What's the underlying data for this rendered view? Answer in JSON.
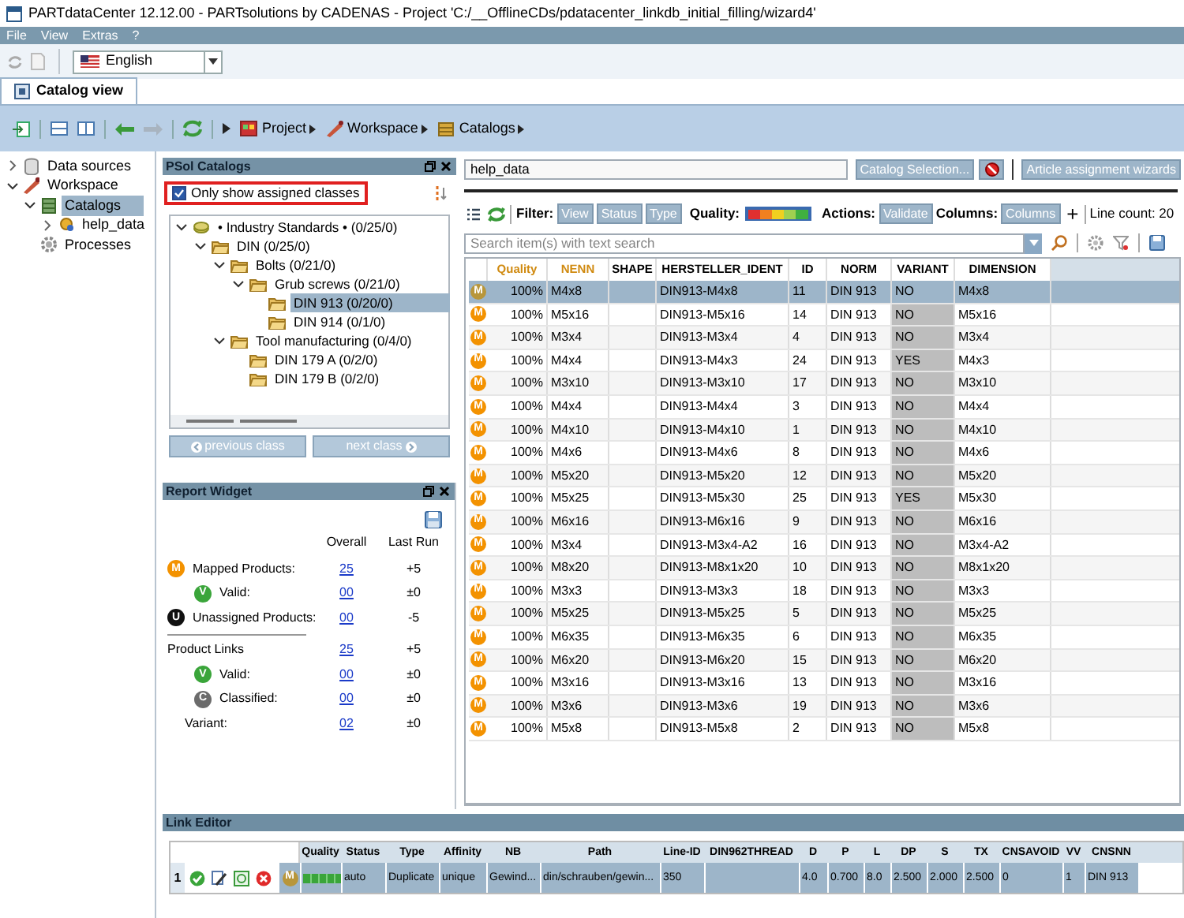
{
  "window": {
    "title": "PARTdataCenter 12.12.00 - PARTsolutions by CADENAS - Project 'C:/__OfflineCDs/pdatacenter_linkdb_initial_filling/wizard4'"
  },
  "menu": [
    "File",
    "View",
    "Extras",
    "?"
  ],
  "language": {
    "value": "English"
  },
  "tabs": [
    {
      "label": "Catalog view",
      "selected": true
    }
  ],
  "breadcrumbs": [
    {
      "label": "Project",
      "kind": "project"
    },
    {
      "label": "Workspace",
      "kind": "workspace"
    },
    {
      "label": "Catalogs",
      "kind": "catalogs"
    }
  ],
  "nav_tree": [
    {
      "label": "Data sources",
      "kind": "datasource",
      "expanded": false,
      "selected": false
    },
    {
      "label": "Workspace",
      "kind": "workspace",
      "expanded": true,
      "selected": false,
      "children": [
        {
          "label": "Catalogs",
          "kind": "catalogs",
          "expanded": true,
          "selected": true,
          "children": [
            {
              "label": "help_data",
              "kind": "catalog",
              "expanded": false,
              "selected": false
            }
          ]
        },
        {
          "label": "Processes",
          "kind": "processes",
          "selected": false
        }
      ]
    }
  ],
  "psol_catalogs": {
    "title": "PSol Catalogs",
    "checkbox": {
      "label": "Only show assigned classes",
      "checked": true
    },
    "tree": [
      {
        "label": "• Industry Standards •",
        "count": "(0/25/0)",
        "kind": "standards",
        "expanded": true,
        "selected": false,
        "children": [
          {
            "label": "DIN",
            "count": "(0/25/0)",
            "kind": "folder",
            "expanded": true,
            "selected": false,
            "children": [
              {
                "label": "Bolts",
                "count": "(0/21/0)",
                "kind": "folder",
                "expanded": true,
                "selected": false,
                "children": [
                  {
                    "label": "Grub screws",
                    "count": "(0/21/0)",
                    "kind": "folder",
                    "expanded": true,
                    "selected": false,
                    "children": [
                      {
                        "label": "DIN 913",
                        "count": "(0/20/0)",
                        "kind": "folder",
                        "selected": true
                      },
                      {
                        "label": "DIN 914",
                        "count": "(0/1/0)",
                        "kind": "folder",
                        "selected": false
                      }
                    ]
                  }
                ]
              },
              {
                "label": "Tool manufacturing",
                "count": "(0/4/0)",
                "kind": "folder",
                "expanded": true,
                "selected": false,
                "children": [
                  {
                    "label": "DIN 179 A",
                    "count": "(0/2/0)",
                    "kind": "folder",
                    "selected": false
                  },
                  {
                    "label": "DIN 179 B",
                    "count": "(0/2/0)",
                    "kind": "folder",
                    "selected": false
                  }
                ]
              }
            ]
          }
        ]
      }
    ],
    "buttons": [
      "previous class",
      "next class"
    ]
  },
  "report_widget": {
    "title": "Report Widget",
    "columns": [
      "Overall",
      "Last Run"
    ],
    "groups": [
      [
        {
          "label": "Mapped Products:",
          "badge": "M",
          "color": "#f39200",
          "overall": "25",
          "last_run": "+5",
          "children": [
            {
              "label": "Valid:",
              "badge": "V",
              "color": "#3aa53a",
              "overall": "00",
              "last_run": "±0"
            }
          ]
        },
        {
          "label": "Unassigned Products:",
          "badge": "U",
          "color": "#111111",
          "overall": "00",
          "last_run": "-5"
        }
      ],
      [
        {
          "label": "Product Links",
          "overall": "25",
          "last_run": "+5",
          "children": [
            {
              "label": "Valid:",
              "badge": "V",
              "color": "#3aa53a",
              "overall": "00",
              "last_run": "±0"
            },
            {
              "label": "Classified:",
              "badge": "C",
              "color": "#6b6b6b",
              "overall": "00",
              "last_run": "±0"
            },
            {
              "label": "Variant:",
              "overall": "02",
              "last_run": "±0"
            }
          ]
        }
      ]
    ]
  },
  "catalog_panel": {
    "catalog_field": "help_data",
    "buttons": [
      "Catalog Selection...",
      "Article assignment wizards"
    ],
    "filter_label": "Filter:",
    "filters": [
      "View",
      "Status",
      "Type"
    ],
    "quality_label": "Quality:",
    "actions_label": "Actions:",
    "actions": [
      "Validate"
    ],
    "columns_label": "Columns:",
    "columns_button": "Columns",
    "add": "+",
    "line_count": "Line count: 20",
    "search": {
      "placeholder": "Search item(s) with text search"
    }
  },
  "table": {
    "columns": [
      {
        "label": "Quality",
        "highlighted": true
      },
      {
        "label": "NENN",
        "highlighted": true
      },
      {
        "label": "SHAPE",
        "highlighted": false
      },
      {
        "label": "HERSTELLER_IDENT",
        "highlighted": false
      },
      {
        "label": "ID",
        "highlighted": false
      },
      {
        "label": "NORM",
        "highlighted": false
      },
      {
        "label": "VARIANT",
        "highlighted": false
      },
      {
        "label": "DIMENSION",
        "highlighted": false
      }
    ],
    "rows": [
      {
        "badge": "M",
        "selected": true,
        "quality": "100%",
        "nenn": "M4x8",
        "ident": "DIN913-M4x8",
        "id": "11",
        "norm": "DIN 913",
        "variant": "NO",
        "dimension": "M4x8"
      },
      {
        "badge": "M",
        "selected": false,
        "quality": "100%",
        "nenn": "M5x16",
        "ident": "DIN913-M5x16",
        "id": "14",
        "norm": "DIN 913",
        "variant": "NO",
        "dimension": "M5x16"
      },
      {
        "badge": "M",
        "selected": false,
        "quality": "100%",
        "nenn": "M3x4",
        "ident": "DIN913-M3x4",
        "id": "4",
        "norm": "DIN 913",
        "variant": "NO",
        "dimension": "M3x4"
      },
      {
        "badge": "M",
        "selected": false,
        "quality": "100%",
        "nenn": "M4x4",
        "ident": "DIN913-M4x3",
        "id": "24",
        "norm": "DIN 913",
        "variant": "YES",
        "dimension": "M4x3"
      },
      {
        "badge": "M",
        "selected": false,
        "quality": "100%",
        "nenn": "M3x10",
        "ident": "DIN913-M3x10",
        "id": "17",
        "norm": "DIN 913",
        "variant": "NO",
        "dimension": "M3x10"
      },
      {
        "badge": "M",
        "selected": false,
        "quality": "100%",
        "nenn": "M4x4",
        "ident": "DIN913-M4x4",
        "id": "3",
        "norm": "DIN 913",
        "variant": "NO",
        "dimension": "M4x4"
      },
      {
        "badge": "M",
        "selected": false,
        "quality": "100%",
        "nenn": "M4x10",
        "ident": "DIN913-M4x10",
        "id": "1",
        "norm": "DIN 913",
        "variant": "NO",
        "dimension": "M4x10"
      },
      {
        "badge": "M",
        "selected": false,
        "quality": "100%",
        "nenn": "M4x6",
        "ident": "DIN913-M4x6",
        "id": "8",
        "norm": "DIN 913",
        "variant": "NO",
        "dimension": "M4x6"
      },
      {
        "badge": "M",
        "selected": false,
        "quality": "100%",
        "nenn": "M5x20",
        "ident": "DIN913-M5x20",
        "id": "12",
        "norm": "DIN 913",
        "variant": "NO",
        "dimension": "M5x20"
      },
      {
        "badge": "M",
        "selected": false,
        "quality": "100%",
        "nenn": "M5x25",
        "ident": "DIN913-M5x30",
        "id": "25",
        "norm": "DIN 913",
        "variant": "YES",
        "dimension": "M5x30"
      },
      {
        "badge": "M",
        "selected": false,
        "quality": "100%",
        "nenn": "M6x16",
        "ident": "DIN913-M6x16",
        "id": "9",
        "norm": "DIN 913",
        "variant": "NO",
        "dimension": "M6x16"
      },
      {
        "badge": "M",
        "selected": false,
        "quality": "100%",
        "nenn": "M3x4",
        "ident": "DIN913-M3x4-A2",
        "id": "16",
        "norm": "DIN 913",
        "variant": "NO",
        "dimension": "M3x4-A2"
      },
      {
        "badge": "M",
        "selected": false,
        "quality": "100%",
        "nenn": "M8x20",
        "ident": "DIN913-M8x1x20",
        "id": "10",
        "norm": "DIN 913",
        "variant": "NO",
        "dimension": "M8x1x20"
      },
      {
        "badge": "M",
        "selected": false,
        "quality": "100%",
        "nenn": "M3x3",
        "ident": "DIN913-M3x3",
        "id": "18",
        "norm": "DIN 913",
        "variant": "NO",
        "dimension": "M3x3"
      },
      {
        "badge": "M",
        "selected": false,
        "quality": "100%",
        "nenn": "M5x25",
        "ident": "DIN913-M5x25",
        "id": "5",
        "norm": "DIN 913",
        "variant": "NO",
        "dimension": "M5x25"
      },
      {
        "badge": "M",
        "selected": false,
        "quality": "100%",
        "nenn": "M6x35",
        "ident": "DIN913-M6x35",
        "id": "6",
        "norm": "DIN 913",
        "variant": "NO",
        "dimension": "M6x35"
      },
      {
        "badge": "M",
        "selected": false,
        "quality": "100%",
        "nenn": "M6x20",
        "ident": "DIN913-M6x20",
        "id": "15",
        "norm": "DIN 913",
        "variant": "NO",
        "dimension": "M6x20"
      },
      {
        "badge": "M",
        "selected": false,
        "quality": "100%",
        "nenn": "M3x16",
        "ident": "DIN913-M3x16",
        "id": "13",
        "norm": "DIN 913",
        "variant": "NO",
        "dimension": "M3x16"
      },
      {
        "badge": "M",
        "selected": false,
        "quality": "100%",
        "nenn": "M3x6",
        "ident": "DIN913-M3x6",
        "id": "19",
        "norm": "DIN 913",
        "variant": "NO",
        "dimension": "M3x6"
      },
      {
        "badge": "M",
        "selected": false,
        "quality": "100%",
        "nenn": "M5x8",
        "ident": "DIN913-M5x8",
        "id": "2",
        "norm": "DIN 913",
        "variant": "NO",
        "dimension": "M5x8"
      }
    ]
  },
  "link_editor": {
    "title": "Link Editor",
    "columns": [
      "Quality",
      "Status",
      "Type",
      "Affinity",
      "NB",
      "Path",
      "Line-ID",
      "DIN962THREAD",
      "D",
      "P",
      "L",
      "DP",
      "S",
      "TX",
      "CNSAVOID",
      "VV",
      "CNSNN"
    ],
    "rows": [
      {
        "number": "1",
        "badge": "M",
        "values": {
          "status": "auto",
          "type": "Duplicate",
          "affinity": "unique",
          "nb": "Gewind...",
          "path": "din/schrauben/gewin...",
          "line_id": "350",
          "d": "4.0",
          "p": "0.700",
          "l": "8.0",
          "dp": "2.500",
          "s": "2.000",
          "tx": "2.500",
          "cnsavoid": "0",
          "vv": "1",
          "cnsnn": "DIN 913"
        }
      }
    ]
  }
}
